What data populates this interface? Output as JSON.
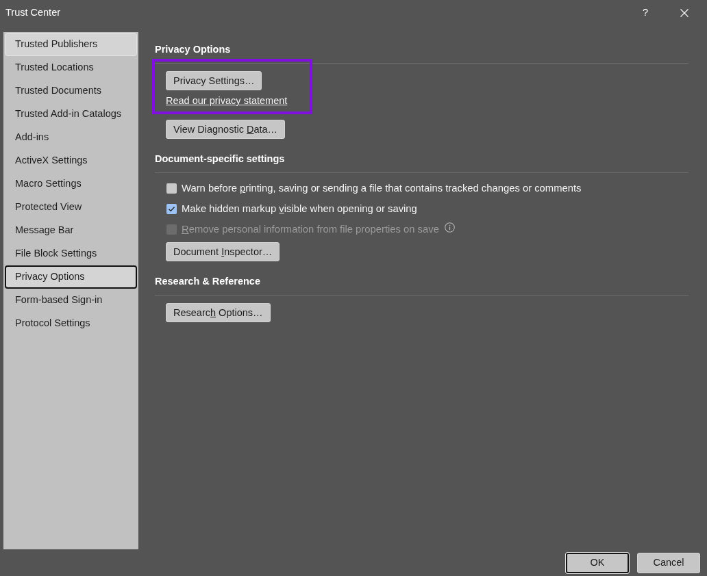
{
  "window": {
    "title": "Trust Center",
    "help_label": "?"
  },
  "sidebar": {
    "items": [
      {
        "label": "Trusted Publishers",
        "selected": false,
        "hovered": true
      },
      {
        "label": "Trusted Locations",
        "selected": false,
        "hovered": false
      },
      {
        "label": "Trusted Documents",
        "selected": false,
        "hovered": false
      },
      {
        "label": "Trusted Add-in Catalogs",
        "selected": false,
        "hovered": false
      },
      {
        "label": "Add-ins",
        "selected": false,
        "hovered": false
      },
      {
        "label": "ActiveX Settings",
        "selected": false,
        "hovered": false
      },
      {
        "label": "Macro Settings",
        "selected": false,
        "hovered": false
      },
      {
        "label": "Protected View",
        "selected": false,
        "hovered": false
      },
      {
        "label": "Message Bar",
        "selected": false,
        "hovered": false
      },
      {
        "label": "File Block Settings",
        "selected": false,
        "hovered": false
      },
      {
        "label": "Privacy Options",
        "selected": true,
        "hovered": false
      },
      {
        "label": "Form-based Sign-in",
        "selected": false,
        "hovered": false
      },
      {
        "label": "Protocol Settings",
        "selected": false,
        "hovered": false
      }
    ]
  },
  "sections": [
    {
      "title": "Privacy Options",
      "items": [
        {
          "kind": "group",
          "highlighted": true,
          "items": [
            {
              "kind": "button",
              "label": "Privacy Settings…"
            },
            {
              "kind": "link",
              "label": "Read our privacy statement"
            }
          ]
        },
        {
          "kind": "button",
          "label_before": "View Diagnostic ",
          "access_key": "D",
          "label_after": "ata…"
        }
      ]
    },
    {
      "title": "Document-specific settings",
      "items": [
        {
          "kind": "checkbox",
          "checked": false,
          "disabled": false,
          "info_icon": false,
          "label_before": "Warn before ",
          "access_key": "p",
          "label_after": "rinting, saving or sending a file that contains tracked changes or comments"
        },
        {
          "kind": "checkbox",
          "checked": true,
          "disabled": false,
          "info_icon": false,
          "label_before": "Make hidden markup ",
          "access_key": "v",
          "label_after": "isible when opening or saving"
        },
        {
          "kind": "checkbox",
          "checked": false,
          "disabled": true,
          "info_icon": true,
          "access_key": "R",
          "label_after": "emove personal information from file properties on save"
        },
        {
          "kind": "button",
          "label_before": "Document ",
          "access_key": "I",
          "label_after": "nspector…"
        }
      ]
    },
    {
      "title": "Research & Reference",
      "items": [
        {
          "kind": "button",
          "label_before": "Researc",
          "access_key": "h",
          "label_after": " Options…"
        }
      ]
    }
  ],
  "footer": {
    "buttons": [
      {
        "label": "OK",
        "default": true
      },
      {
        "label": "Cancel",
        "default": false
      }
    ]
  }
}
